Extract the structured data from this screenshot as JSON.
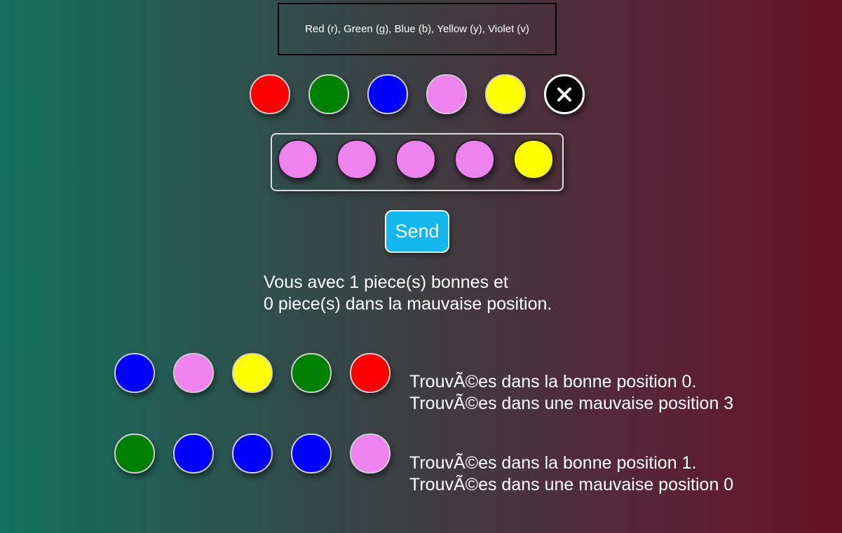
{
  "legend_text": "Red (r), Green (g), Blue (b), Yellow (y), Violet (v)",
  "palette": [
    {
      "name": "red",
      "color": "#ff0000"
    },
    {
      "name": "green",
      "color": "#008000"
    },
    {
      "name": "blue",
      "color": "#0000ff"
    },
    {
      "name": "violet",
      "color": "#ee82ee"
    },
    {
      "name": "yellow",
      "color": "#ffff00"
    }
  ],
  "clear_icon": "close-icon",
  "current_guess": [
    "#ee82ee",
    "#ee82ee",
    "#ee82ee",
    "#ee82ee",
    "#ffff00"
  ],
  "send_label": "Send",
  "result": {
    "line1": "Vous avec 1 piece(s) bonnes et",
    "line2": "0 piece(s) dans la mauvaise position."
  },
  "history": [
    {
      "colors": [
        "#0000ff",
        "#ee82ee",
        "#ffff00",
        "#008000",
        "#ff0000"
      ],
      "line1": "TrouvÃ©es dans la bonne position 0.",
      "line2": "TrouvÃ©es dans une mauvaise position 3"
    },
    {
      "colors": [
        "#008000",
        "#0000ff",
        "#0000ff",
        "#0000ff",
        "#ee82ee"
      ],
      "line1": "TrouvÃ©es dans la bonne position 1.",
      "line2": "TrouvÃ©es dans une mauvaise position 0"
    }
  ]
}
